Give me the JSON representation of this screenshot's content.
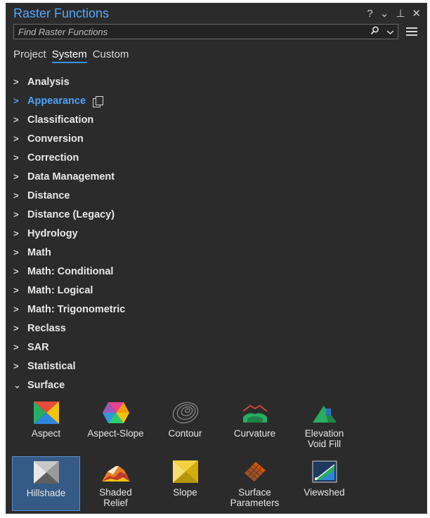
{
  "window": {
    "title": "Raster Functions",
    "controls": {
      "help": "?",
      "menu": "⌄",
      "pin": "⊥",
      "close": "✕"
    }
  },
  "search": {
    "placeholder": "Find Raster Functions"
  },
  "tabs": [
    {
      "label": "Project"
    },
    {
      "label": "System",
      "active": true
    },
    {
      "label": "Custom"
    }
  ],
  "tree": {
    "categories": [
      "Analysis",
      "Appearance",
      "Classification",
      "Conversion",
      "Correction",
      "Data Management",
      "Distance",
      "Distance (Legacy)",
      "Hydrology",
      "Math",
      "Math: Conditional",
      "Math: Logical",
      "Math: Trigonometric",
      "Reclass",
      "SAR",
      "Statistical",
      "Surface"
    ],
    "highlighted": "Appearance",
    "expanded": "Surface"
  },
  "surface_functions": [
    {
      "label": "Aspect",
      "icon": "aspect-icon"
    },
    {
      "label": "Aspect-Slope",
      "icon": "aspect-slope-icon"
    },
    {
      "label": "Contour",
      "icon": "contour-icon"
    },
    {
      "label": "Curvature",
      "icon": "curvature-icon"
    },
    {
      "label": "Elevation\nVoid Fill",
      "icon": "elevation-void-fill-icon"
    },
    {
      "label": "Hillshade",
      "icon": "hillshade-icon",
      "selected": true
    },
    {
      "label": "Shaded\nRelief",
      "icon": "shaded-relief-icon"
    },
    {
      "label": "Slope",
      "icon": "slope-icon"
    },
    {
      "label": "Surface\nParameters",
      "icon": "surface-parameters-icon"
    },
    {
      "label": "Viewshed",
      "icon": "viewshed-icon"
    }
  ],
  "colors": {
    "accent": "#54a7ff",
    "panel_bg": "#2b2b2b",
    "selected_tile": "#345a85"
  }
}
